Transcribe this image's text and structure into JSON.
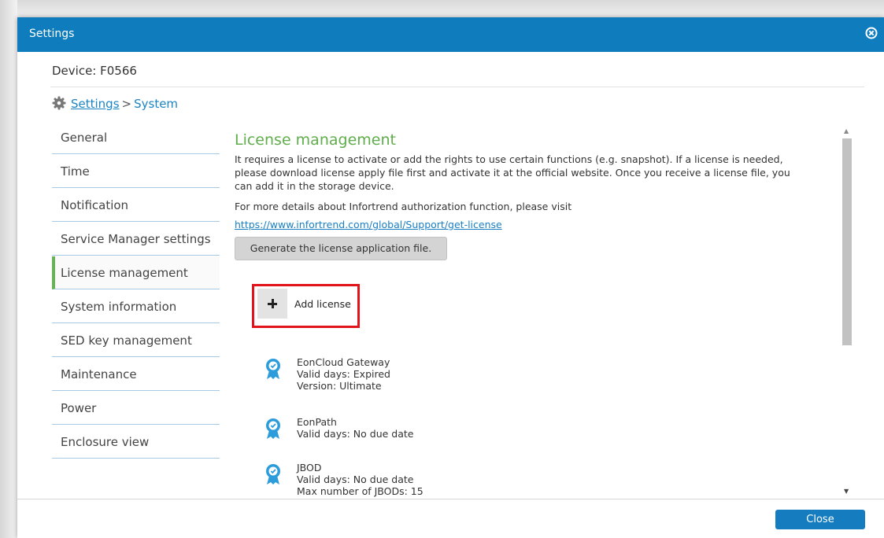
{
  "dialog": {
    "title": "Settings"
  },
  "device": {
    "label": "Device: F0566"
  },
  "breadcrumb": {
    "root": "Settings",
    "separator": ">",
    "current": "System"
  },
  "nav": {
    "items": [
      {
        "label": "General"
      },
      {
        "label": "Time"
      },
      {
        "label": "Notification"
      },
      {
        "label": "Service Manager settings"
      },
      {
        "label": "License management",
        "active": true
      },
      {
        "label": "System information"
      },
      {
        "label": "SED key management"
      },
      {
        "label": "Maintenance"
      },
      {
        "label": "Power"
      },
      {
        "label": "Enclosure view"
      }
    ]
  },
  "license": {
    "title": "License management",
    "description": "It requires a license to activate or add the rights to use certain functions (e.g. snapshot). If a license is needed, please download license apply file first and activate it at the official website. Once you receive a license file, you can add it in the storage device.",
    "more_text": "For more details about Infortrend authorization function, please visit",
    "link_text": "https://www.infortrend.com/global/Support/get-license",
    "generate_button": "Generate the license application file.",
    "add_button": "Add license",
    "items": [
      {
        "name": "EonCloud Gateway",
        "lines": [
          "Valid days: Expired",
          "Version: Ultimate"
        ]
      },
      {
        "name": "EonPath",
        "lines": [
          "Valid days: No due date"
        ]
      },
      {
        "name": "JBOD",
        "lines": [
          "Valid days: No due date",
          "Max number of JBODs: 15"
        ]
      }
    ]
  },
  "footer": {
    "close_button": "Close"
  },
  "colors": {
    "titlebar": "#0f7dbd",
    "accent_green": "#5fae4b",
    "link_blue": "#1a7fc2",
    "highlight_red": "#e1141b",
    "badge_blue": "#2d9cdb"
  },
  "icons": {
    "close": "close-circle-icon",
    "settings": "gear-icon",
    "add": "plus-icon",
    "license": "award-badge-icon"
  }
}
